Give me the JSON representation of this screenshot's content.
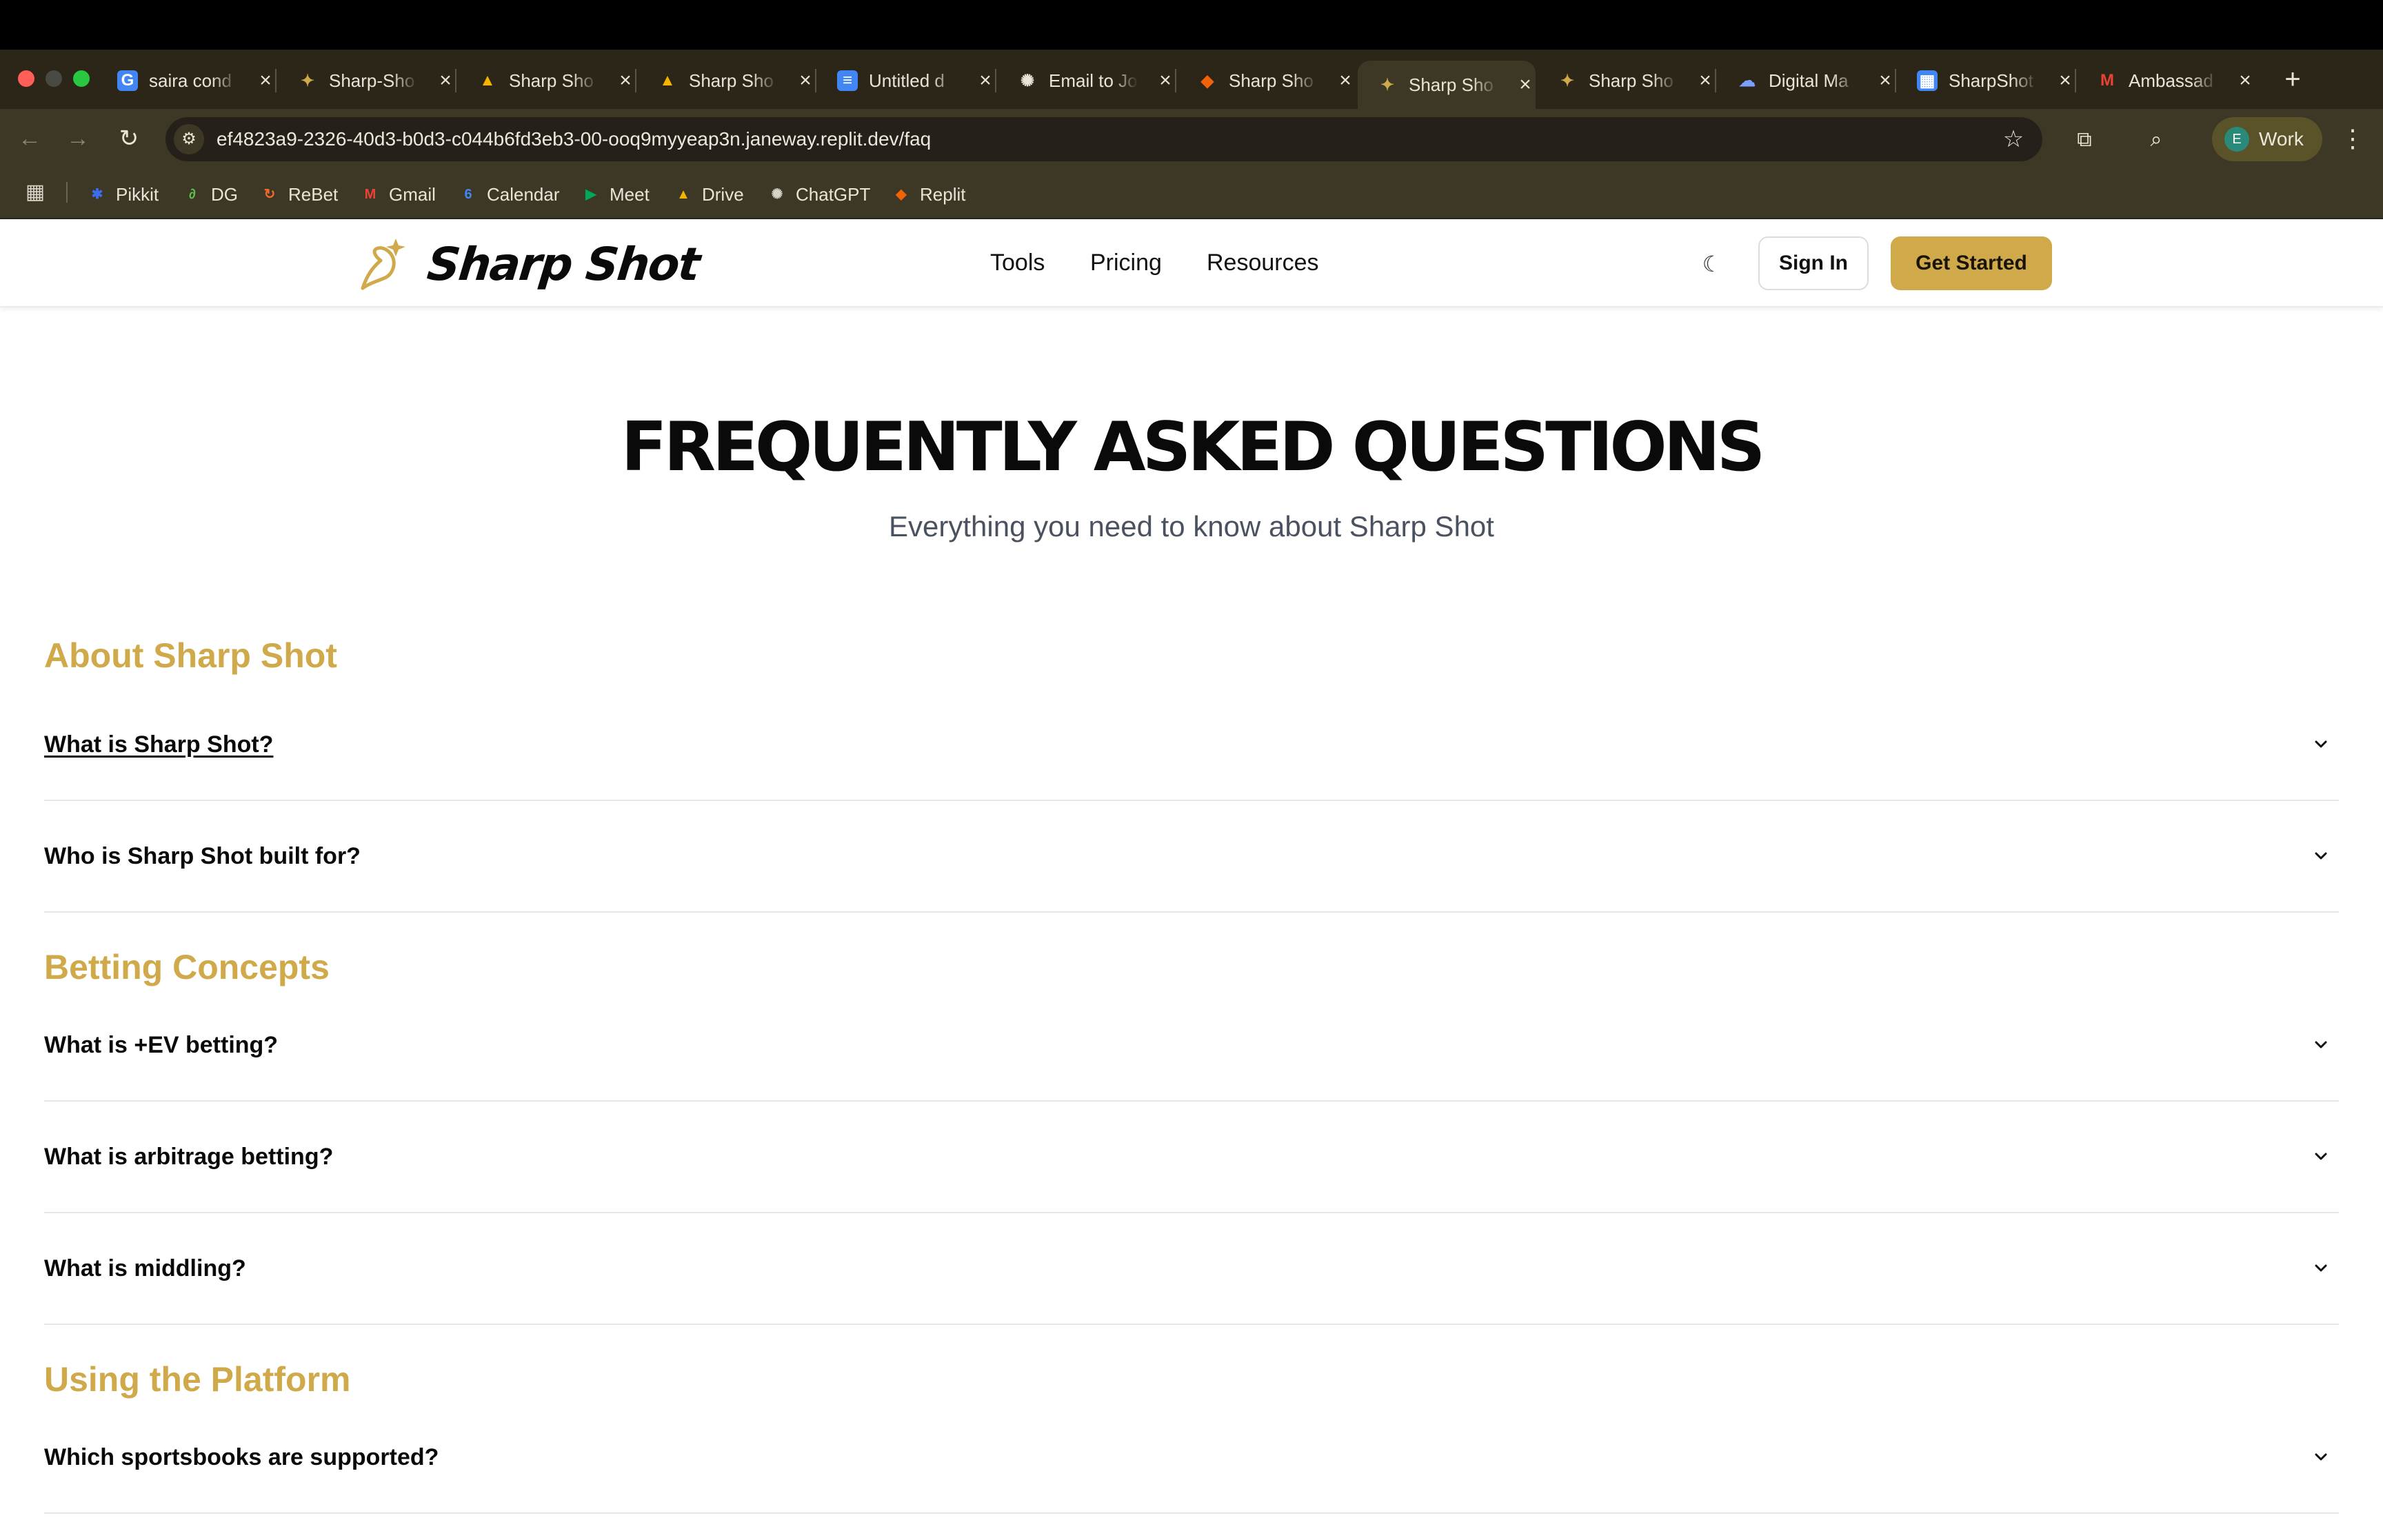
{
  "browser": {
    "tabs": [
      {
        "title": "saira cond",
        "icon": "google-icon",
        "active": false
      },
      {
        "title": "Sharp-Sho",
        "icon": "sharp-shot-icon",
        "active": false
      },
      {
        "title": "Sharp Sho",
        "icon": "google-drive-icon",
        "active": false
      },
      {
        "title": "Sharp Sho",
        "icon": "google-drive-icon",
        "active": false
      },
      {
        "title": "Untitled d",
        "icon": "google-docs-icon",
        "active": false
      },
      {
        "title": "Email to Jo",
        "icon": "chatgpt-icon",
        "active": false
      },
      {
        "title": "Sharp Sho",
        "icon": "replit-icon",
        "active": false
      },
      {
        "title": "Sharp Sho",
        "icon": "sharp-shot-icon",
        "active": true
      },
      {
        "title": "Sharp Sho",
        "icon": "sharp-shot-icon",
        "active": false
      },
      {
        "title": "Digital Ma",
        "icon": "cloud-icon",
        "active": false
      },
      {
        "title": "SharpShot",
        "icon": "google-sheets-icon",
        "active": false
      },
      {
        "title": "Ambassad",
        "icon": "gmail-icon",
        "active": false
      }
    ],
    "url": "ef4823a9-2326-40d3-b0d3-c044b6fd3eb3-00-ooq9myyeap3n.janeway.replit.dev/faq",
    "profile": {
      "initial": "E",
      "label": "Work"
    },
    "bookmarks": [
      {
        "label": "Pikkit",
        "icon": "pikkit-icon",
        "color": "#3d6cf0"
      },
      {
        "label": "DG",
        "icon": "dg-icon",
        "color": "#5cc04a"
      },
      {
        "label": "ReBet",
        "icon": "rebet-icon",
        "color": "#f06a2a"
      },
      {
        "label": "Gmail",
        "icon": "gmail-icon",
        "color": "#ea4335"
      },
      {
        "label": "Calendar",
        "icon": "calendar-icon",
        "color": "#4285f4"
      },
      {
        "label": "Meet",
        "icon": "meet-icon",
        "color": "#00a85a"
      },
      {
        "label": "Drive",
        "icon": "drive-icon",
        "color": "#f4b400"
      },
      {
        "label": "ChatGPT",
        "icon": "chatgpt-icon",
        "color": "#d8d4c8"
      },
      {
        "label": "Replit",
        "icon": "replit-icon",
        "color": "#f26207"
      }
    ]
  },
  "site": {
    "brand": "Sharp Shot",
    "nav": [
      "Tools",
      "Pricing",
      "Resources"
    ],
    "sign_in": "Sign In",
    "get_started": "Get Started",
    "accent_color": "#cfa94a"
  },
  "faq": {
    "title": "FREQUENTLY ASKED QUESTIONS",
    "subtitle": "Everything you need to know about Sharp Shot",
    "sections": [
      {
        "heading": "About Sharp Shot",
        "questions": [
          "What is Sharp Shot?",
          "Who is Sharp Shot built for?"
        ]
      },
      {
        "heading": "Betting Concepts",
        "questions": [
          "What is +EV betting?",
          "What is arbitrage betting?",
          "What is middling?"
        ]
      },
      {
        "heading": "Using the Platform",
        "questions": [
          "Which sportsbooks are supported?"
        ]
      }
    ]
  }
}
